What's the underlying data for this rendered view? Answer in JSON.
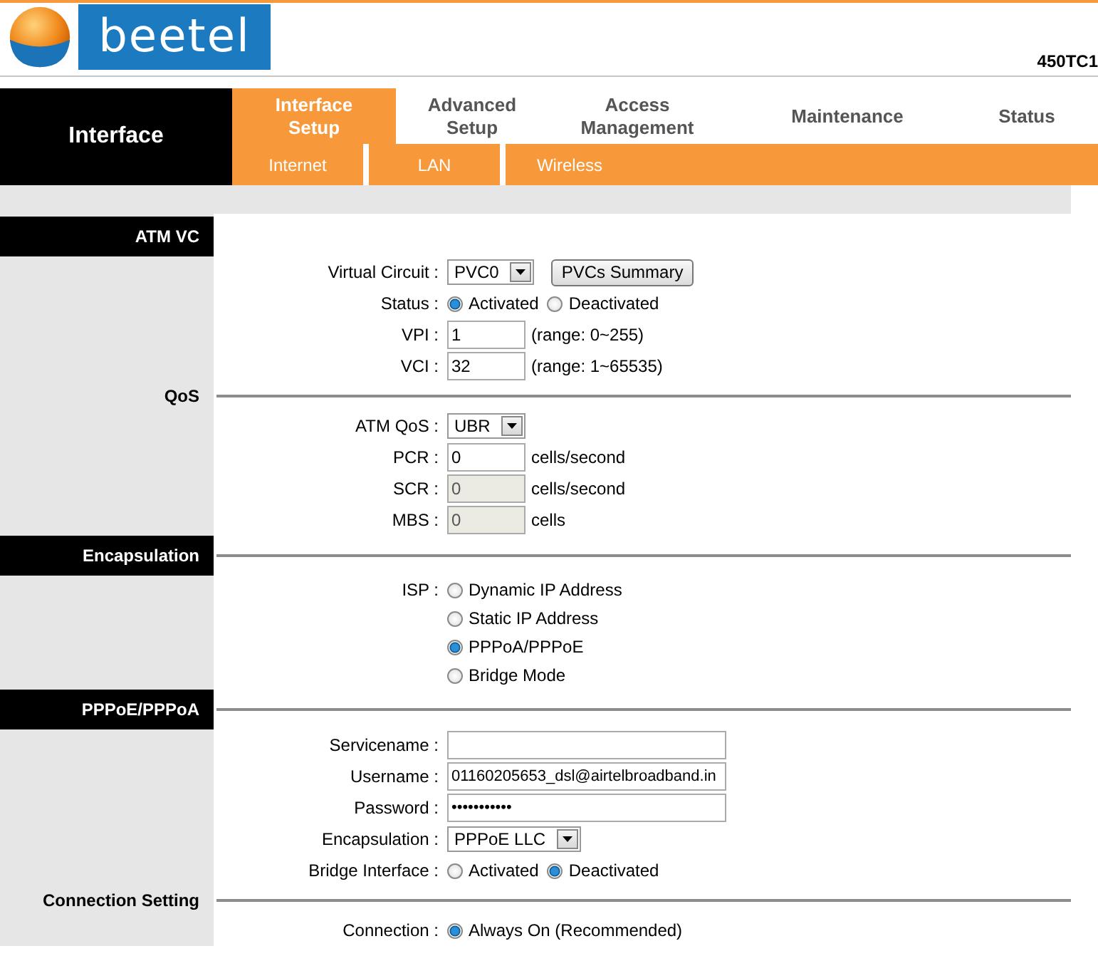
{
  "header": {
    "logo": "beetel",
    "model": "450TC1"
  },
  "nav": {
    "section": "Interface",
    "tabs": [
      {
        "label": "Interface Setup",
        "selected": true
      },
      {
        "label": "Advanced Setup",
        "selected": false
      },
      {
        "label": "Access Management",
        "selected": false
      },
      {
        "label": "Maintenance",
        "selected": false
      },
      {
        "label": "Status",
        "selected": false
      }
    ],
    "subtabs": [
      "Internet",
      "LAN",
      "Wireless"
    ]
  },
  "sections": [
    {
      "title": "ATM VC",
      "kind": "banner",
      "rows": [
        {
          "kind": "select",
          "label": "Virtual Circuit :",
          "value": "PVC0",
          "button": "PVCs Summary"
        },
        {
          "kind": "radios",
          "label": "Status :",
          "options": [
            {
              "label": "Activated",
              "selected": true
            },
            {
              "label": "Deactivated",
              "selected": false
            }
          ]
        },
        {
          "kind": "number",
          "label": "VPI :",
          "value": "1",
          "disabled": false,
          "note": "(range: 0~255)"
        },
        {
          "kind": "number",
          "label": "VCI :",
          "value": "32",
          "disabled": false,
          "note": "(range: 1~65535)"
        }
      ]
    },
    {
      "title": "QoS",
      "kind": "divider",
      "rows": [
        {
          "kind": "select",
          "label": "ATM QoS :",
          "value": "UBR"
        },
        {
          "kind": "number",
          "label": "PCR :",
          "value": "0",
          "disabled": false,
          "note": "cells/second"
        },
        {
          "kind": "number",
          "label": "SCR :",
          "value": "0",
          "disabled": true,
          "note": "cells/second"
        },
        {
          "kind": "number",
          "label": "MBS :",
          "value": "0",
          "disabled": true,
          "note": "cells"
        }
      ]
    },
    {
      "title": "Encapsulation",
      "kind": "banner",
      "rows": [
        {
          "kind": "radio-list",
          "label": "ISP :",
          "options": [
            {
              "label": "Dynamic IP Address",
              "selected": false
            },
            {
              "label": "Static IP Address",
              "selected": false
            },
            {
              "label": "PPPoA/PPPoE",
              "selected": true
            },
            {
              "label": "Bridge Mode",
              "selected": false
            }
          ]
        }
      ]
    },
    {
      "title": "PPPoE/PPPoA",
      "kind": "banner",
      "rows": [
        {
          "kind": "text",
          "label": "Servicename :",
          "value": "",
          "disabled": false
        },
        {
          "kind": "text",
          "label": "Username :",
          "value": "01160205653_dsl@airtelbroadband.in",
          "disabled": false
        },
        {
          "kind": "text",
          "label": "Password :",
          "value": "•••••••••••",
          "disabled": false
        },
        {
          "kind": "select",
          "label": "Encapsulation :",
          "value": "PPPoE LLC"
        },
        {
          "kind": "radios",
          "label": "Bridge Interface :",
          "options": [
            {
              "label": "Activated",
              "selected": false
            },
            {
              "label": "Deactivated",
              "selected": true
            }
          ]
        }
      ]
    },
    {
      "title": "Connection Setting",
      "kind": "divider",
      "rows": [
        {
          "kind": "radios",
          "label": "Connection :",
          "options": [
            {
              "label": "Always On (Recommended)",
              "selected": true
            }
          ]
        }
      ]
    }
  ]
}
